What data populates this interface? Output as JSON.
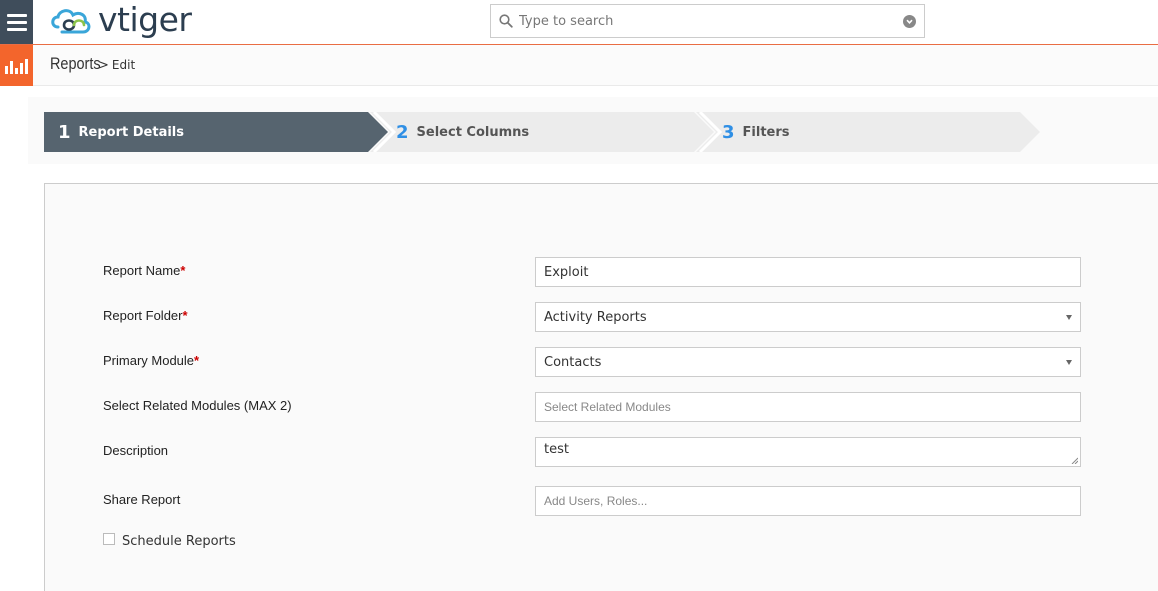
{
  "header": {
    "logo_text": "vtiger",
    "search": {
      "placeholder": "Type to search",
      "value": ""
    }
  },
  "breadcrumb": {
    "module": "Reports",
    "separator": ">",
    "page": "Edit"
  },
  "steps": [
    {
      "number": "1",
      "label": "Report Details",
      "active": true
    },
    {
      "number": "2",
      "label": "Select Columns",
      "active": false
    },
    {
      "number": "3",
      "label": "Filters",
      "active": false
    }
  ],
  "form": {
    "required_mark": "*",
    "report_name": {
      "label": "Report Name",
      "value": "Exploit"
    },
    "report_folder": {
      "label": "Report Folder",
      "value": "Activity Reports"
    },
    "primary_module": {
      "label": "Primary Module",
      "value": "Contacts"
    },
    "related_modules": {
      "label": "Select Related Modules (MAX 2)",
      "placeholder": "Select Related Modules"
    },
    "description": {
      "label": "Description",
      "value": "test"
    },
    "share_report": {
      "label": "Share Report",
      "placeholder": "Add Users, Roles..."
    },
    "schedule_reports": {
      "label": "Schedule Reports",
      "checked": false
    }
  },
  "colors": {
    "nav_dark": "#3f4d5b",
    "accent_orange": "#f3652c",
    "step_active": "#56646f",
    "step_inactive": "#ececec",
    "step_number_blue": "#2f8fe5",
    "required_red": "#cc0000"
  }
}
